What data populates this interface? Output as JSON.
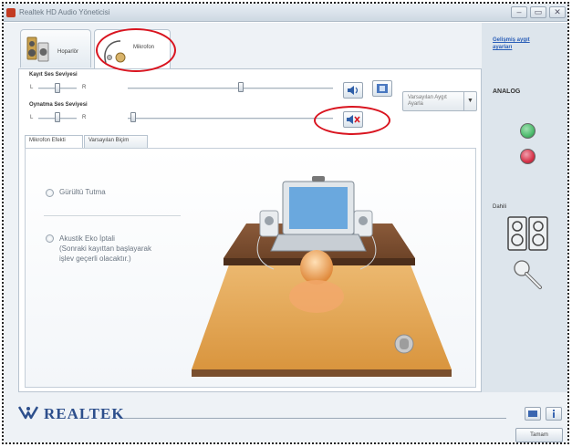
{
  "window": {
    "title": "Realtek HD Audio Yöneticisi",
    "buttons": [
      "–",
      "▭",
      "✕"
    ]
  },
  "tabs": [
    {
      "label": "Hoparlör"
    },
    {
      "label": "Mikrofon"
    }
  ],
  "recording": {
    "label": "Kayıt Ses Seviyesi",
    "left": "L",
    "right": "R"
  },
  "playback": {
    "label": "Oynatma Ses Seviyesi",
    "left": "L",
    "right": "R"
  },
  "default_device": {
    "value": "Varsayılan Aygıt Ayarla"
  },
  "subtabs": [
    {
      "label": "Mikrofon Efekti"
    },
    {
      "label": "Varsayılan Biçim"
    }
  ],
  "effects": {
    "noise_suppression": "Gürültü Tutma",
    "echo_cancel": "Akustik Eko İptali",
    "echo_cancel_note_1": "(Sonraki kayıttan başlayarak",
    "echo_cancel_note_2": "işlev geçerli olacaktır.)"
  },
  "sidebar": {
    "link_1": "Gelişmiş aygıt",
    "link_2": "ayarları",
    "analog_title": "ANALOG",
    "digital_title": "Dahili"
  },
  "footer": {
    "brand": "REALTEK",
    "ok_label": "Tamam"
  },
  "colors": {
    "accent": "#2b5fb8",
    "annotation": "#d9141f",
    "jack_green": "#4dbb6d",
    "jack_pink": "#d7344a"
  },
  "icons": [
    "speaker-icon",
    "microphone-icon",
    "mute-icon",
    "mic-boost-icon",
    "headphone-icon",
    "realtek-logo-icon",
    "info-icon"
  ]
}
